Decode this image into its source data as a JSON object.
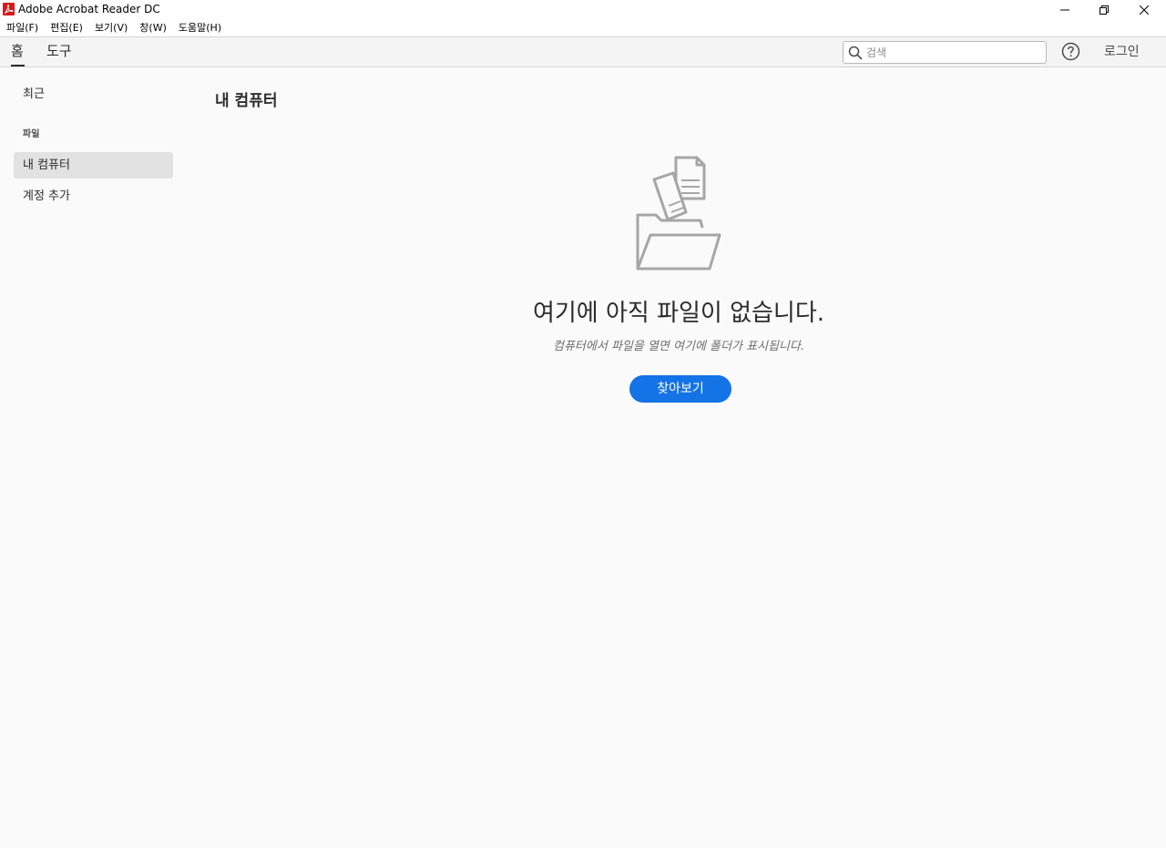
{
  "window": {
    "title": "Adobe Acrobat Reader DC",
    "controls": {
      "minimize": "minimize-icon",
      "restore": "restore-icon",
      "close": "close-icon"
    }
  },
  "menubar": {
    "items": [
      "파일(F)",
      "편집(E)",
      "보기(V)",
      "창(W)",
      "도움말(H)"
    ]
  },
  "tabs": {
    "home": "홈",
    "tools": "도구",
    "selected": "홈"
  },
  "search": {
    "placeholder": "검색",
    "value": ""
  },
  "header_actions": {
    "help_icon": "question-circle-icon",
    "signin_label": "로그인"
  },
  "sidebar": {
    "recent": "최근",
    "files_header": "파일",
    "my_computer": "내 컴퓨터",
    "add_account": "계정 추가",
    "selected": "내 컴퓨터"
  },
  "main": {
    "title": "내 컴퓨터",
    "empty_state": {
      "icon": "folder-with-document-icon",
      "title": "여기에 아직 파일이 없습니다.",
      "subtitle": "컴퓨터에서 파일을 열면 여기에 폴더가 표시됩니다.",
      "button_label": "찾아보기"
    }
  },
  "colors": {
    "accent": "#1473e6",
    "background": "#fafafa",
    "logo": "#d7191c"
  }
}
